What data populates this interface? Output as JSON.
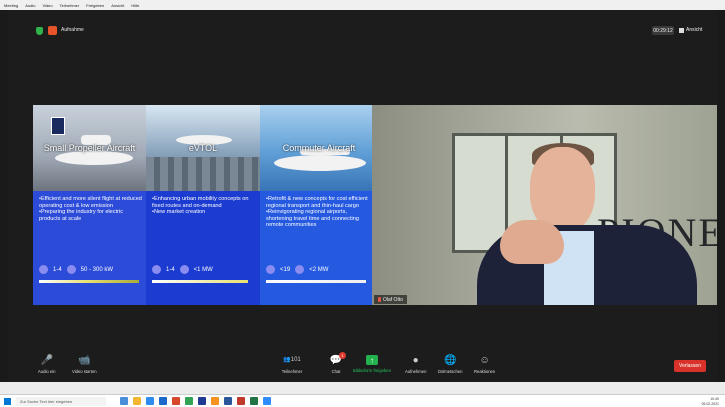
{
  "menubar": [
    "Meeting",
    "Audio",
    "Video",
    "Teilnehmer",
    "Freigeben",
    "Ansicht",
    "Hilfe"
  ],
  "topbar": {
    "recording_label": "Aufnahme",
    "timer": "00:29:12",
    "view_label": "Ansicht"
  },
  "slide": {
    "panels": [
      {
        "title": "Small Propeller Aircraft",
        "bullets": [
          "•Efficient and more silent flight at reduced operating cost & low emission",
          "•Preparing the industry for electric products at scale"
        ],
        "seats": "1-4",
        "power": "50 - 300 kW"
      },
      {
        "title": "eVTOL",
        "bullets": [
          "•Enhancing urban mobility concepts on fixed routes and on-demand",
          "•New market creation"
        ],
        "seats": "1-4",
        "power": "<1 MW"
      },
      {
        "title": "Commuter Aircraft",
        "bullets": [
          "•Retrofit & new concepts for cost efficient regional transport and thin-haul cargo",
          "•Reinvigorating regional airports, shortening travel time and connecting remote communities"
        ],
        "seats": "<19",
        "power": "<2 MW"
      }
    ]
  },
  "video": {
    "participant_name": "Olaf Otto",
    "sign_text": "PIONE"
  },
  "toolbar": {
    "audio": "Audio ein",
    "video": "Video starten",
    "participants": "Teilnehmer",
    "participants_count": "101",
    "chat": "Chat",
    "chat_badge": "1",
    "share": "Bildschirm freigeben",
    "record": "Aufnehmen",
    "interpret": "Dolmetschen",
    "reactions": "Reaktionen",
    "leave": "Verlassen"
  },
  "taskbar": {
    "search_placeholder": "Zur Suche Text hier eingeben",
    "time": "10:49",
    "date": "09.02.2021"
  },
  "colors": {
    "share_green": "#22b14c",
    "leave_red": "#d9322a",
    "slide_blue": "#2b4bd8"
  }
}
